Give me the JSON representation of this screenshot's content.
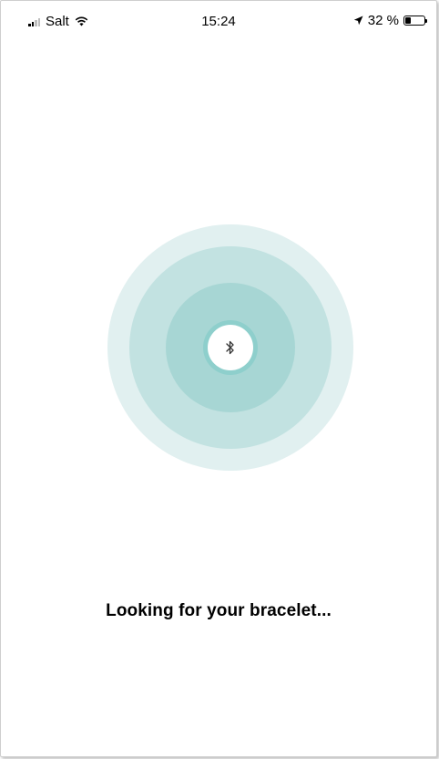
{
  "status_bar": {
    "carrier": "Salt",
    "time": "15:24",
    "battery_text": "32 %",
    "battery_level": 0.32,
    "icons": [
      "signal-icon",
      "wifi-icon",
      "location-arrow-icon",
      "battery-icon"
    ]
  },
  "scanner": {
    "icon": "bluetooth-icon",
    "colors": {
      "outer": "#e1f0f0",
      "middle": "#c2e2e1",
      "inner": "#a7d6d4",
      "core": "#8ecfcc"
    }
  },
  "message": "Looking for your bracelet..."
}
